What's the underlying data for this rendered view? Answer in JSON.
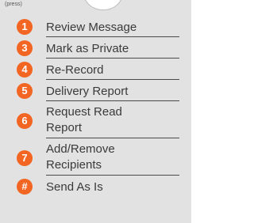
{
  "press_label": "(press)",
  "accent_color": "#f26522",
  "menu": [
    {
      "key": "1",
      "label": "Review Message"
    },
    {
      "key": "3",
      "label": "Mark as Private"
    },
    {
      "key": "4",
      "label": "Re-Record"
    },
    {
      "key": "5",
      "label": "Delivery Report"
    },
    {
      "key": "6",
      "label_line1": "Request Read",
      "label_line2": "Report"
    },
    {
      "key": "7",
      "label_line1": "Add/Remove",
      "label_line2": "Recipients"
    },
    {
      "key": "#",
      "label": "Send As Is"
    }
  ]
}
